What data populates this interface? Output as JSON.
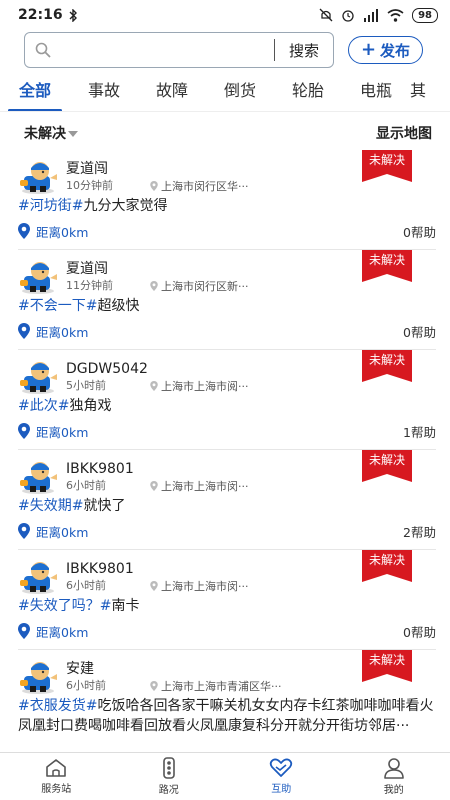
{
  "status_bar": {
    "time": "22:16",
    "battery": "98"
  },
  "search": {
    "placeholder": "",
    "button_label": "搜索"
  },
  "publish": {
    "label": "发布"
  },
  "tabs": [
    {
      "label": "全部",
      "active": true
    },
    {
      "label": "事故"
    },
    {
      "label": "故障"
    },
    {
      "label": "倒货"
    },
    {
      "label": "轮胎"
    },
    {
      "label": "电瓶"
    },
    {
      "label": "其"
    }
  ],
  "filter": {
    "status_label": "未解决",
    "map_label": "显示地图"
  },
  "posts": [
    {
      "username": "夏道闯",
      "time": "10分钟前",
      "location": "上海市闵行区华···",
      "badge": "未解决",
      "tag": "#河坊街#",
      "text": "九分大家觉得",
      "distance": "距离0km",
      "help": "0帮助"
    },
    {
      "username": "夏道闯",
      "time": "11分钟前",
      "location": "上海市闵行区新···",
      "badge": "未解决",
      "tag": "#不会一下#",
      "text": "超级快",
      "distance": "距离0km",
      "help": "0帮助"
    },
    {
      "username": "DGDW5042",
      "time": "5小时前",
      "location": "上海市上海市阅···",
      "badge": "未解决",
      "tag": "#此次#",
      "text": "独角戏",
      "distance": "距离0km",
      "help": "1帮助"
    },
    {
      "username": "IBKK9801",
      "time": "6小时前",
      "location": "上海市上海市闵···",
      "badge": "未解决",
      "tag": "#失效期#",
      "text": "就快了",
      "distance": "距离0km",
      "help": "2帮助"
    },
    {
      "username": "IBKK9801",
      "time": "6小时前",
      "location": "上海市上海市闵···",
      "badge": "未解决",
      "tag": "#失效了吗？#",
      "text": "南卡",
      "distance": "距离0km",
      "help": "0帮助"
    },
    {
      "username": "安建",
      "time": "6小时前",
      "location": "上海市上海市青浦区华···",
      "badge": "未解决",
      "tag": "#衣服发货#",
      "text": "吃饭哈各回各家干嘛关机女女内存卡红茶咖啡咖啡看火凤凰封口费喝咖啡看回放看火凤凰康复科分开就分开街坊邻居···",
      "distance": "",
      "help": ""
    }
  ],
  "bottom_nav": [
    {
      "label": "服务站",
      "icon": "home-icon"
    },
    {
      "label": "路况",
      "icon": "traffic-light-icon"
    },
    {
      "label": "互助",
      "icon": "handshake-icon",
      "active": true
    },
    {
      "label": "我的",
      "icon": "user-icon"
    }
  ],
  "colors": {
    "accent": "#1c5bbf",
    "badge": "#d71920"
  }
}
